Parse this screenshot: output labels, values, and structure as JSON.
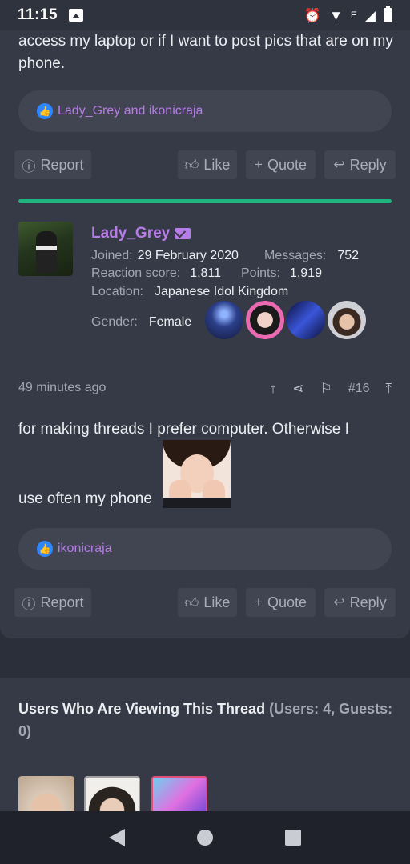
{
  "status_bar": {
    "time": "11:15",
    "network": "E"
  },
  "post_prev": {
    "text": "access my laptop or if I want to post pics that are on my phone.",
    "reactions": "Lady_Grey and ikonicraja",
    "actions": {
      "report": "Report",
      "like": "Like",
      "quote": "Quote",
      "reply": "Reply"
    }
  },
  "user": {
    "name": "Lady_Grey",
    "joined_label": "Joined:",
    "joined": "29 February 2020",
    "messages_label": "Messages:",
    "messages": "752",
    "reaction_label": "Reaction score:",
    "reaction": "1,811",
    "points_label": "Points:",
    "points": "1,919",
    "location_label": "Location:",
    "location": "Japanese Idol Kingdom",
    "gender_label": "Gender:",
    "gender": "Female"
  },
  "post": {
    "time": "49 minutes ago",
    "number": "#16",
    "text_line1": "for making threads I prefer computer. Otherwise I",
    "text_line2": "use often my phone",
    "reactions": "ikonicraja",
    "actions": {
      "report": "Report",
      "like": "Like",
      "quote": "Quote",
      "reply": "Reply"
    }
  },
  "viewing": {
    "title": "Users Who Are Viewing This Thread",
    "counts": "(Users: 4, Guests: 0)"
  },
  "colors": {
    "accent": "#b77ce8",
    "divider": "#21b37e",
    "like": "#2d88ff"
  }
}
